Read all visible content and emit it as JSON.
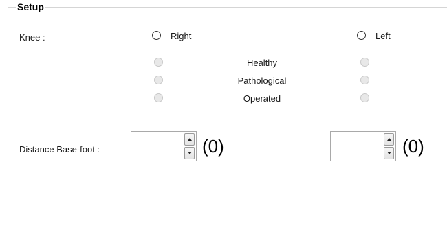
{
  "group": {
    "title": "Setup"
  },
  "knee": {
    "label": "Knee :",
    "right_label": "Right",
    "left_label": "Left",
    "conditions": [
      "Healthy",
      "Pathological",
      "Operated"
    ]
  },
  "distance": {
    "label": "Distance Base-foot :",
    "right_value": "",
    "right_display": "(0)",
    "left_value": "",
    "left_display": "(0)"
  }
}
